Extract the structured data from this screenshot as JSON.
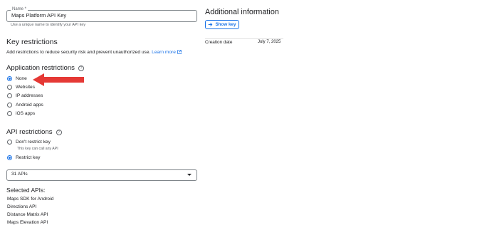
{
  "name_field": {
    "label": "Name *",
    "value": "Maps Platform API Key",
    "helper": "Use a unique name to identify your API key"
  },
  "key_restrictions": {
    "title": "Key restrictions",
    "description": "Add restrictions to reduce security risk and prevent unauthorized use.",
    "learn_more": "Learn more"
  },
  "application_restrictions": {
    "title": "Application restrictions",
    "options": [
      {
        "label": "None",
        "checked": true
      },
      {
        "label": "Websites",
        "checked": false
      },
      {
        "label": "IP addresses",
        "checked": false
      },
      {
        "label": "Android apps",
        "checked": false
      },
      {
        "label": "iOS apps",
        "checked": false
      }
    ]
  },
  "api_restrictions": {
    "title": "API restrictions",
    "options": [
      {
        "label": "Don't restrict key",
        "sub": "This key can call any API",
        "checked": false
      },
      {
        "label": "Restrict key",
        "checked": true
      }
    ],
    "select_value": "31 APIs"
  },
  "selected_apis": {
    "title": "Selected APIs:",
    "items": [
      "Maps SDK for Android",
      "Directions API",
      "Distance Matrix API",
      "Maps Elevation API"
    ]
  },
  "additional_info": {
    "title": "Additional information",
    "show_key": "Show key",
    "creation_date_label": "Creation date",
    "creation_date_value": "July 7, 2025"
  },
  "colors": {
    "accent": "#1a73e8",
    "arrow": "#e53935",
    "text": "#202124"
  }
}
